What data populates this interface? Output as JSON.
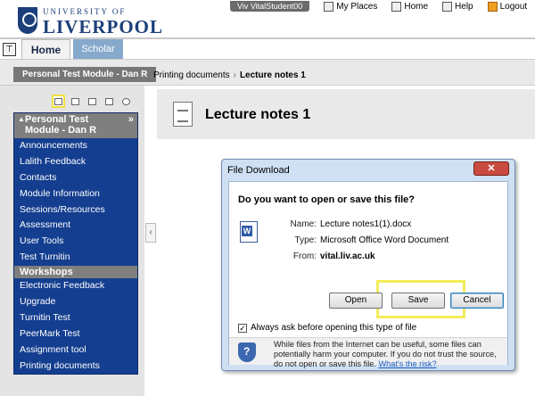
{
  "header": {
    "university_line": "UNIVERSITY OF",
    "university_name": "LIVERPOOL",
    "user": "Viv VitalStudent00",
    "links": {
      "my_places": "My Places",
      "home": "Home",
      "help": "Help",
      "logout": "Logout"
    },
    "tabs": {
      "home": "Home",
      "scholar": "Scholar"
    }
  },
  "breadcrumb": {
    "module": "Personal Test Module - Dan R",
    "path": "Printing documents",
    "separator": "›",
    "current": "Lecture notes 1"
  },
  "menu": {
    "arrow": "▲",
    "title": "Personal Test Module - Dan R",
    "collapse": "»",
    "items_top": [
      "Announcements",
      "Lalith Feedback",
      "Contacts",
      "Module Information",
      "Sessions/Resources",
      "Assessment",
      "User Tools",
      "Test Turnitin"
    ],
    "divider": "Workshops",
    "items_bottom": [
      "Electronic Feedback",
      "Upgrade",
      "Turnitin Test",
      "PeerMark Test",
      "Assignment tool",
      "Printing documents"
    ]
  },
  "content": {
    "title": "Lecture notes 1",
    "collapse_handle": "‹"
  },
  "dialog": {
    "title": "File Download",
    "close": "✕",
    "question": "Do you want to open or save this file?",
    "name_label": "Name:",
    "name_value": "Lecture notes1(1).docx",
    "type_label": "Type:",
    "type_value": "Microsoft Office Word Document",
    "from_label": "From:",
    "from_value": "vital.liv.ac.uk",
    "buttons": {
      "open": "Open",
      "save": "Save",
      "cancel": "Cancel"
    },
    "checkbox_mark": "✓",
    "always_ask": "Always ask before opening this type of file",
    "warning": "While files from the Internet can be useful, some files can potentially harm your computer. If you do not trust the source, do not open or save this file.",
    "warning_link": "What's the risk?"
  }
}
